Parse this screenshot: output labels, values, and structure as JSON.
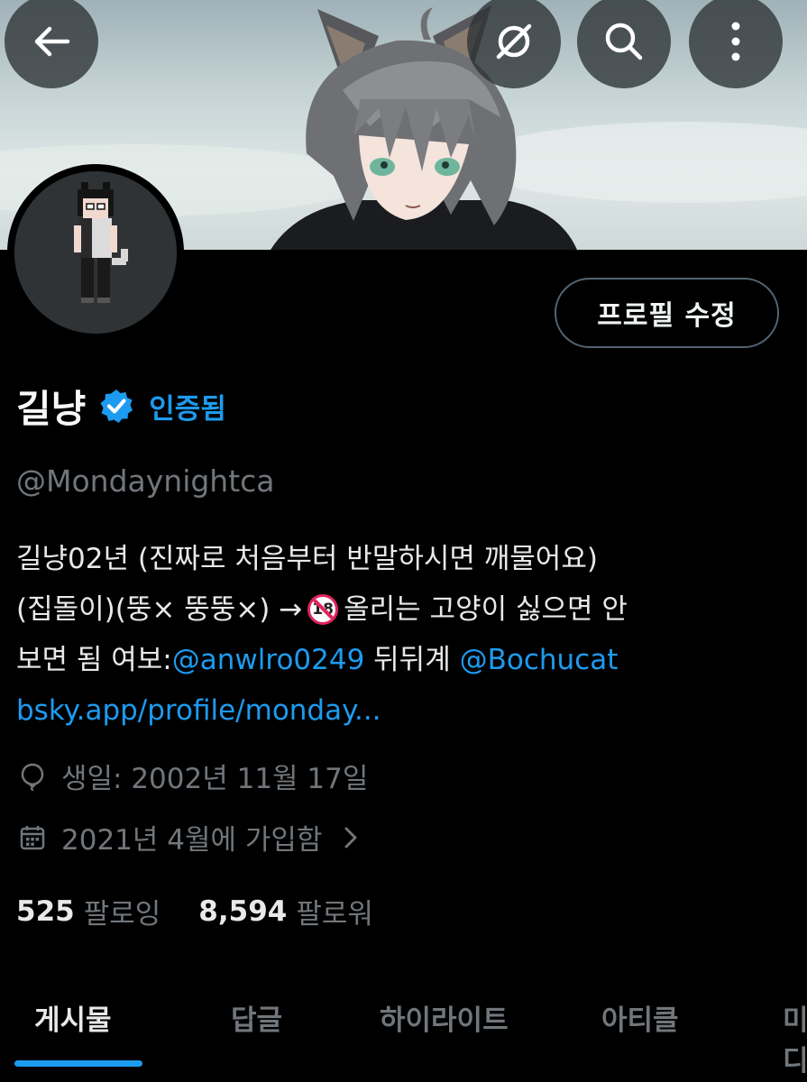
{
  "header": {
    "back_icon": "back-arrow-icon",
    "grok_icon": "grok-slash-icon",
    "search_icon": "search-icon",
    "more_icon": "more-vertical-icon"
  },
  "profile": {
    "display_name": "길냥",
    "verified_label": "인증됨",
    "handle": "@Mondaynightca",
    "edit_button": "프로필 수정"
  },
  "bio": {
    "line1": "길냥02년  (진짜로 처음부터 반말하시면 깨물어요)",
    "line2_before": "(집돌이)(뚱× 뚱뚱×) →",
    "no18_text": "18",
    "line2_after": " 올리는 고양이 싫으면 안",
    "line3_before": "보면 됨 여보:",
    "mention1": "@anwlro0249",
    "line3_middle": " 뒤뒤계 ",
    "mention2": "@Bochucat",
    "link": "bsky.app/profile/monday..."
  },
  "meta": {
    "birthday": "생일: 2002년 11월 17일",
    "joined": "2021년 4월에 가입함"
  },
  "stats": {
    "following_count": "525",
    "following_label": "팔로잉",
    "followers_count": "8,594",
    "followers_label": "팔로워"
  },
  "tabs": [
    "게시물",
    "답글",
    "하이라이트",
    "아티클",
    "미디어"
  ],
  "colors": {
    "accent": "#1d9bf0",
    "background": "#000000",
    "secondary_text": "#71767b"
  }
}
